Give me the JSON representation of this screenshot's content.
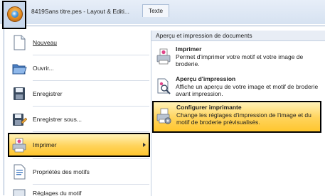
{
  "titlebar": {
    "title": "8419Sans titre.pes - Layout & Editi...",
    "tab_label": "Texte"
  },
  "menu": {
    "left_items": [
      {
        "label": "Nouveau",
        "icon": "new-document-icon"
      },
      {
        "label": "Ouvrir...",
        "icon": "open-folder-icon"
      },
      {
        "label": "Enregistrer",
        "icon": "save-disk-icon"
      },
      {
        "label": "Enregistrer sous...",
        "icon": "save-as-disk-icon"
      },
      {
        "label": "Imprimer",
        "icon": "printer-icon"
      },
      {
        "label": "Propriétés des motifs",
        "icon": "properties-document-icon"
      },
      {
        "label": "Réglages du motif",
        "icon": "settings-icon"
      }
    ],
    "right_header": "Aperçu et impression de documents",
    "right_items": [
      {
        "title": "Imprimer",
        "desc": "Permet d'imprimer votre motif et votre image de broderie.",
        "icon": "printer-icon"
      },
      {
        "title": "Aperçu d'impression",
        "desc": "Affiche un aperçu de votre image et motif de broderie avant impression.",
        "icon": "print-preview-icon"
      },
      {
        "title": "Configurer imprimante",
        "desc": "Change les réglages d'impression de l'image et du motif de broderie prévisualisés.",
        "icon": "printer-setup-icon"
      }
    ]
  },
  "colors": {
    "highlight": "#ffd35a",
    "titlebar": "#d6e2f1",
    "accent_orange": "#e38a1e"
  }
}
